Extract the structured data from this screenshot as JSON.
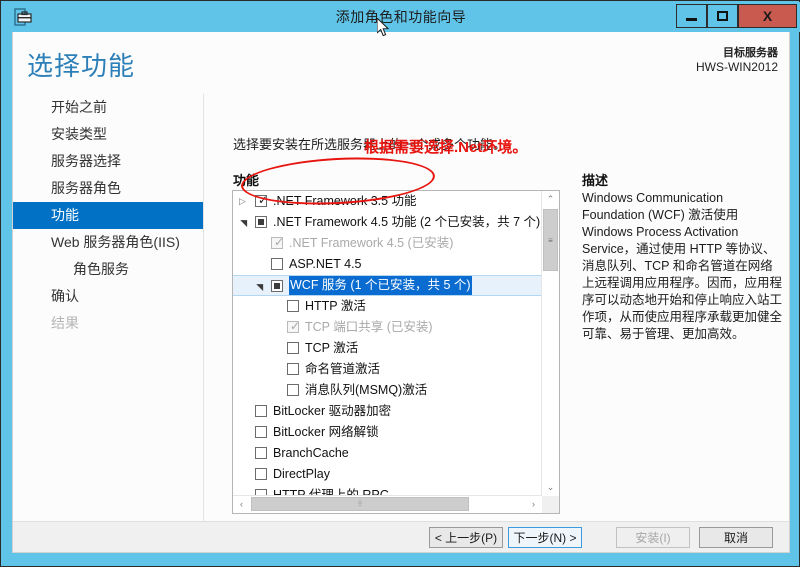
{
  "window": {
    "title": "添加角色和功能向导",
    "icon": "server-wizard-icon",
    "minimize_label": "—",
    "maximize_label": "□",
    "close_label": "X"
  },
  "header": {
    "page_title": "选择功能",
    "target_server_label": "目标服务器",
    "target_server_name": "HWS-WIN2012"
  },
  "sidebar": {
    "items": [
      {
        "label": "开始之前",
        "state": "normal"
      },
      {
        "label": "安装类型",
        "state": "normal"
      },
      {
        "label": "服务器选择",
        "state": "normal"
      },
      {
        "label": "服务器角色",
        "state": "normal"
      },
      {
        "label": "功能",
        "state": "active"
      },
      {
        "label": "Web 服务器角色(IIS)",
        "state": "normal"
      },
      {
        "label": "角色服务",
        "state": "sub"
      },
      {
        "label": "确认",
        "state": "normal"
      },
      {
        "label": "结果",
        "state": "disabled"
      }
    ]
  },
  "main": {
    "instruction": "选择要安装在所选服务器上的一个或多个功能。",
    "features_label": "功能",
    "description_label": "描述",
    "description_text": "Windows Communication Foundation (WCF) 激活使用 Windows Process Activation Service，通过使用 HTTP 等协议、消息队列、TCP 和命名管道在网络上远程调用应用程序。因而，应用程序可以动态地开始和停止响应入站工作项，从而使应用程序承载更加健全可靠、易于管理、更加高效。",
    "tree": [
      {
        "label": ".NET Framework 3.5 功能",
        "level": 0,
        "expander": "collapsed",
        "checkbox": "checked",
        "dim": false,
        "selected": false
      },
      {
        "label": ".NET Framework 4.5 功能 (2 个已安装，共 7 个)",
        "level": 0,
        "expander": "expanded",
        "checkbox": "partial",
        "dim": false,
        "selected": false
      },
      {
        "label": ".NET Framework 4.5 (已安装)",
        "level": 1,
        "expander": "none",
        "checkbox": "checked-disabled",
        "dim": true,
        "selected": false
      },
      {
        "label": "ASP.NET 4.5",
        "level": 1,
        "expander": "none",
        "checkbox": "unchecked",
        "dim": false,
        "selected": false
      },
      {
        "label": "WCF 服务 (1 个已安装，共 5 个)",
        "level": 1,
        "expander": "expanded",
        "checkbox": "partial",
        "dim": false,
        "selected": true
      },
      {
        "label": "HTTP 激活",
        "level": 2,
        "expander": "none",
        "checkbox": "unchecked",
        "dim": false,
        "selected": false
      },
      {
        "label": "TCP 端口共享 (已安装)",
        "level": 2,
        "expander": "none",
        "checkbox": "checked-disabled",
        "dim": true,
        "selected": false
      },
      {
        "label": "TCP 激活",
        "level": 2,
        "expander": "none",
        "checkbox": "unchecked",
        "dim": false,
        "selected": false
      },
      {
        "label": "命名管道激活",
        "level": 2,
        "expander": "none",
        "checkbox": "unchecked",
        "dim": false,
        "selected": false
      },
      {
        "label": "消息队列(MSMQ)激活",
        "level": 2,
        "expander": "none",
        "checkbox": "unchecked",
        "dim": false,
        "selected": false
      },
      {
        "label": "BitLocker 驱动器加密",
        "level": 0,
        "expander": "none",
        "checkbox": "unchecked",
        "dim": false,
        "selected": false
      },
      {
        "label": "BitLocker 网络解锁",
        "level": 0,
        "expander": "none",
        "checkbox": "unchecked",
        "dim": false,
        "selected": false
      },
      {
        "label": "BranchCache",
        "level": 0,
        "expander": "none",
        "checkbox": "unchecked",
        "dim": false,
        "selected": false
      },
      {
        "label": "DirectPlay",
        "level": 0,
        "expander": "none",
        "checkbox": "unchecked",
        "dim": false,
        "selected": false
      },
      {
        "label": "HTTP 代理上的 RPC",
        "level": 0,
        "expander": "none",
        "checkbox": "unchecked",
        "dim": false,
        "selected": false
      }
    ],
    "scrollbar": {
      "up_arrow": "⌃",
      "down_arrow": "⌄",
      "left_arrow": "‹",
      "right_arrow": "›",
      "thumb_grip": "≡",
      "h_thumb_grip": "⦙⦙"
    }
  },
  "footer": {
    "previous_label": "< 上一步(P)",
    "next_label": "下一步(N) >",
    "install_label": "安装(I)",
    "cancel_label": "取消"
  },
  "annotation": {
    "note_text": "根据需要选择.Net环境。",
    "note_color": "#e8140f"
  },
  "colors": {
    "title_bar": "#5fc4e8",
    "accent_blue": "#0071c5",
    "page_title_blue": "#2d7fb8",
    "close_red": "#c85a50",
    "selection_blue": "#0a6cd0"
  }
}
